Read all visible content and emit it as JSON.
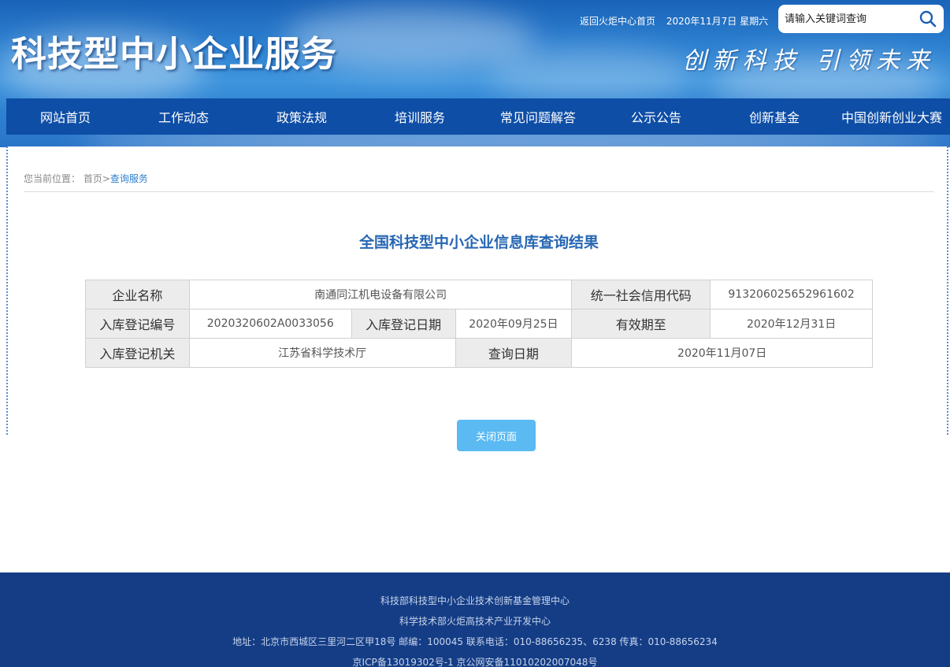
{
  "header": {
    "site_title": "科技型中小企业服务",
    "slogan": "创新科技  引领未来",
    "back_link": "返回火炬中心首页",
    "date_text": "2020年11月7日 星期六",
    "search_placeholder": "请输入关键词查询",
    "search_icon": "search-icon"
  },
  "nav": {
    "items": [
      {
        "label": "网站首页"
      },
      {
        "label": "工作动态"
      },
      {
        "label": "政策法规"
      },
      {
        "label": "培训服务"
      },
      {
        "label": "常见问题解答"
      },
      {
        "label": "公示公告"
      },
      {
        "label": "创新基金"
      },
      {
        "label": "中国创新创业大赛"
      }
    ]
  },
  "breadcrumb": {
    "prefix": "您当前位置：",
    "home": "首页",
    "separator": ">",
    "current": "查询服务"
  },
  "result": {
    "title": "全国科技型中小企业信息库查询结果",
    "company_name_label": "企业名称",
    "company_name": "南通同江机电设备有限公司",
    "credit_code_label": "统一社会信用代码",
    "credit_code": "913206025652961602",
    "reg_no_label": "入库登记编号",
    "reg_no": "2020320602A0033056",
    "reg_date_label": "入库登记日期",
    "reg_date": "2020年09月25日",
    "valid_until_label": "有效期至",
    "valid_until": "2020年12月31日",
    "reg_authority_label": "入库登记机关",
    "reg_authority": "江苏省科学技术厅",
    "query_date_label": "查询日期",
    "query_date": "2020年11月07日"
  },
  "close_button": "关闭页面",
  "footer": {
    "line1": "科技部科技型中小企业技术创新基金管理中心",
    "line2": "科学技术部火炬高技术产业开发中心",
    "line3": "地址：北京市西城区三里河二区甲18号 邮编：100045 联系电话：010-88656235、6238 传真：010-88656234",
    "line4": "京ICP备13019302号-1 京公网安备11010202007048号"
  },
  "colors": {
    "nav_bg": "#0e4ea6",
    "title_blue": "#2767b3",
    "button_bg": "#5bbaf2",
    "footer_bg": "#143d86"
  }
}
